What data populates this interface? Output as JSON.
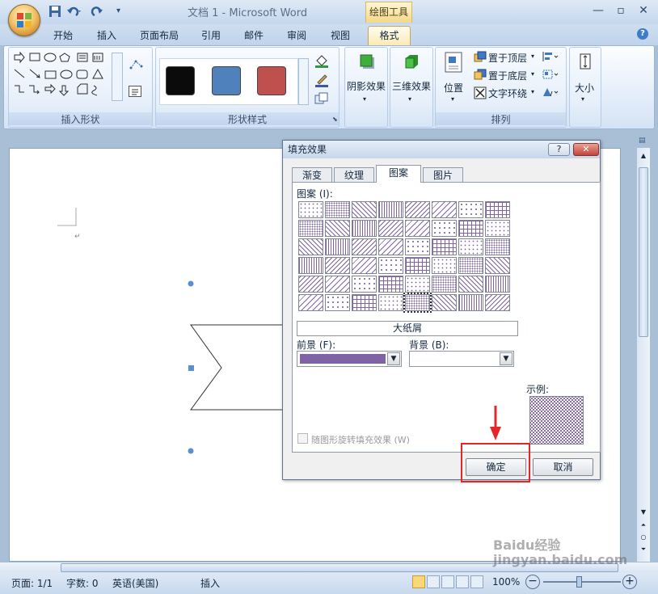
{
  "window": {
    "title": "文档 1 - Microsoft Word",
    "tool_context": "绘图工具"
  },
  "tabs": [
    "开始",
    "插入",
    "页面布局",
    "引用",
    "邮件",
    "审阅",
    "视图"
  ],
  "active_tab": "格式",
  "ribbon": {
    "groups": {
      "insert_shapes": "插入形状",
      "shape_styles": "形状样式",
      "arrange": "排列"
    },
    "buttons": {
      "shadow": "阴影效果",
      "threed": "三维效果",
      "position": "位置",
      "bring_front": "置于顶层",
      "send_back": "置于底层",
      "text_wrap": "文字环绕",
      "size": "大小"
    },
    "style_swatches": [
      "#0b0b0b",
      "#4f81bd",
      "#c0504d"
    ]
  },
  "dialog": {
    "title": "填充效果",
    "tabs": [
      "渐变",
      "纹理",
      "图案",
      "图片"
    ],
    "active_tab": "图案",
    "pattern_label": "图案 (I):",
    "selected_pattern_name": "大纸屑",
    "foreground_label": "前景 (F):",
    "background_label": "背景 (B):",
    "foreground_color": "#7f63a6",
    "sample_label": "示例:",
    "rotate_checkbox": "随图形旋转填充效果 (W)",
    "ok": "确定",
    "cancel": "取消"
  },
  "status": {
    "page": "页面: 1/1",
    "words": "字数: 0",
    "language": "英语(美国)",
    "mode": "插入",
    "zoom": "100%"
  },
  "watermark": "Baidu经验 jingyan.baidu.com",
  "colors": {
    "accent": "#e3262a",
    "pattern": "#7f63a6"
  }
}
